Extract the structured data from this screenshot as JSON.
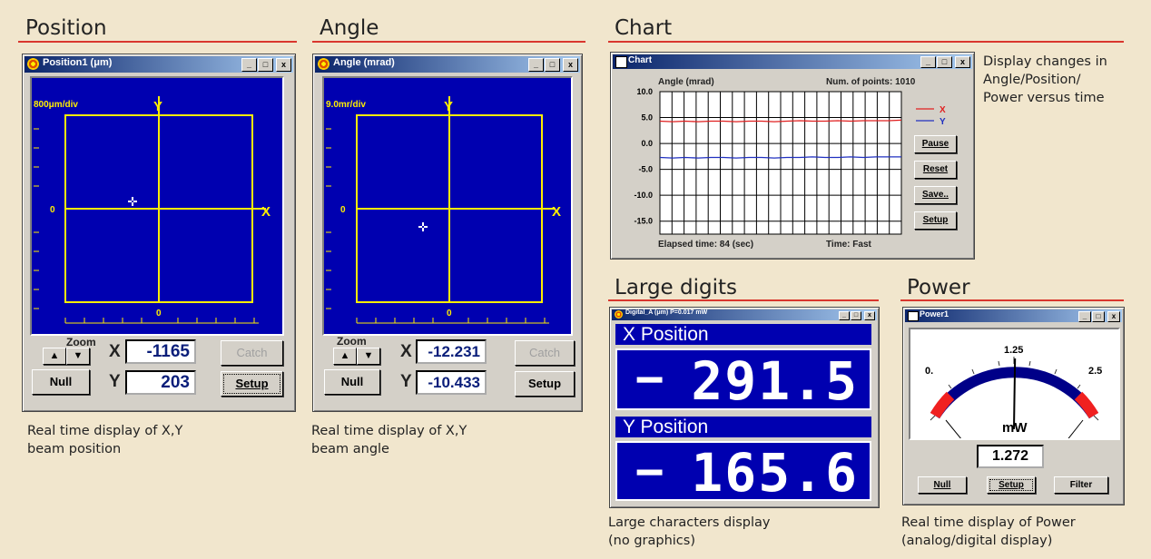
{
  "sections": {
    "position": "Position",
    "angle": "Angle",
    "chart": "Chart",
    "large_digits": "Large digits",
    "power": "Power"
  },
  "captions": {
    "position_l1": "Real time display of X,Y",
    "position_l2": "beam position",
    "angle_l1": "Real time display of X,Y",
    "angle_l2": "beam angle",
    "chart_l1": "Display changes in",
    "chart_l2": "Angle/Position/",
    "chart_l3": "Power versus time",
    "digits_l1": "Large characters display",
    "digits_l2": "(no graphics)",
    "power_l1": "Real time display of Power",
    "power_l2": "(analog/digital display)"
  },
  "title_buttons": {
    "min": "_",
    "max": "□",
    "close": "x"
  },
  "position_window": {
    "title": "Position1  (μm)",
    "scale": "800μm/div",
    "x_label": "X",
    "y_label": "Y",
    "zero_x": "0",
    "zero_y": "0",
    "zoom": "Zoom",
    "zoom_up": "▲",
    "zoom_down": "▼",
    "x_field_label": "X",
    "y_field_label": "Y",
    "x_value": "-1165",
    "y_value": "203",
    "null": "Null",
    "catch": "Catch",
    "setup": "Setup"
  },
  "angle_window": {
    "title": "Angle   (mrad)",
    "scale": "9.0mr/div",
    "x_label": "X",
    "y_label": "Y",
    "zero_x": "0",
    "zero_y": "0",
    "zoom": "Zoom",
    "zoom_up": "▲",
    "zoom_down": "▼",
    "x_field_label": "X",
    "y_field_label": "Y",
    "x_value": "-12.231",
    "y_value": "-10.433",
    "null": "Null",
    "catch": "Catch",
    "setup": "Setup"
  },
  "chart_window": {
    "title": "Chart",
    "header_left": "Angle (mrad)",
    "header_right": "Num. of points: 1010",
    "footer_left": "Elapsed time: 84 (sec)",
    "footer_right": "Time:   Fast",
    "pause": "Pause",
    "reset": "Reset",
    "save": "Save..",
    "setup": "Setup"
  },
  "chart_data": {
    "type": "line",
    "ylim": [
      -17.5,
      10
    ],
    "y_ticks": [
      "10.0",
      "5.0",
      "0.0",
      "-5.0",
      "-10.0",
      "-15.0"
    ],
    "y_tick_values": [
      10,
      5,
      0,
      -5,
      -10,
      -15
    ],
    "series": [
      {
        "name": "X",
        "color": "#e02020",
        "values": [
          4.3,
          4.2,
          4.3,
          4.2,
          4.3,
          4.3,
          4.2,
          4.3,
          4.3,
          4.2,
          4.3,
          4.4,
          4.3,
          4.3,
          4.4,
          4.3,
          4.4,
          4.4,
          4.4,
          4.5
        ]
      },
      {
        "name": "Y",
        "color": "#2030c0",
        "values": [
          -2.7,
          -2.8,
          -2.7,
          -2.8,
          -2.7,
          -2.7,
          -2.8,
          -2.7,
          -2.7,
          -2.8,
          -2.7,
          -2.7,
          -2.6,
          -2.7,
          -2.7,
          -2.6,
          -2.7,
          -2.6,
          -2.6,
          -2.6
        ]
      }
    ]
  },
  "digits_window": {
    "title": "Digital_A (μm)   P=0.017 mW",
    "x_header": "X Position",
    "x_sign": "−",
    "x_value": "291.5",
    "y_header": "Y Position",
    "y_sign": "−",
    "y_value": "165.6"
  },
  "power_window": {
    "title": "Power1",
    "scale_min": "0.",
    "scale_mid": "1.25",
    "scale_max": "2.5",
    "unit": "mW",
    "value": "1.272",
    "reading_mw": 1.272,
    "full_scale_mw": 2.5,
    "null": "Null",
    "setup": "Setup",
    "filter": "Filter"
  },
  "colors": {
    "background": "#f1e6cd",
    "accent_rule": "#d9362d",
    "display_blue": "#0000b0",
    "crosshair": "#ffee00"
  }
}
